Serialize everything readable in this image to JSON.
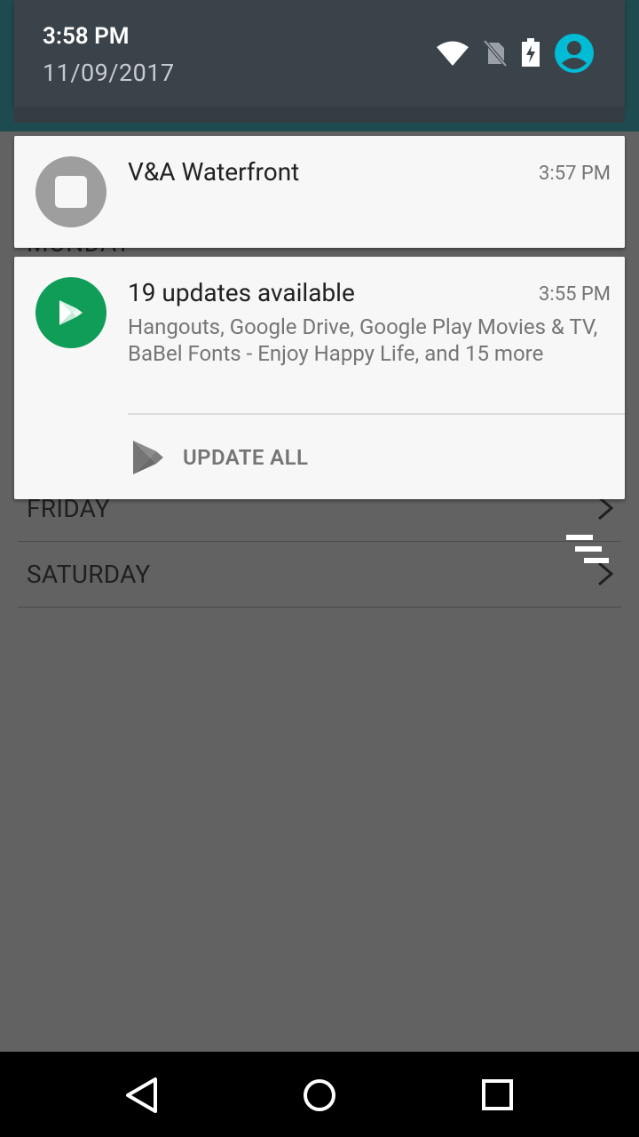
{
  "status": {
    "time": "3:58 PM",
    "date": "11/09/2017"
  },
  "background_list": {
    "days": [
      "MONDAY",
      "FRIDAY",
      "SATURDAY"
    ]
  },
  "notifications": [
    {
      "title": "V&A Waterfront",
      "time": "3:57 PM",
      "icon": "stop-icon"
    },
    {
      "title": "19 updates available",
      "time": "3:55 PM",
      "text": "Hangouts, Google Drive, Google Play Movies & TV, BaBel Fonts - Enjoy Happy Life, and 15 more",
      "icon": "play-store-icon",
      "action_label": "UPDATE ALL"
    }
  ],
  "colors": {
    "play_green": "#0f9d58",
    "accent_cyan": "#00bcd4",
    "header_bg": "#3b434a"
  }
}
